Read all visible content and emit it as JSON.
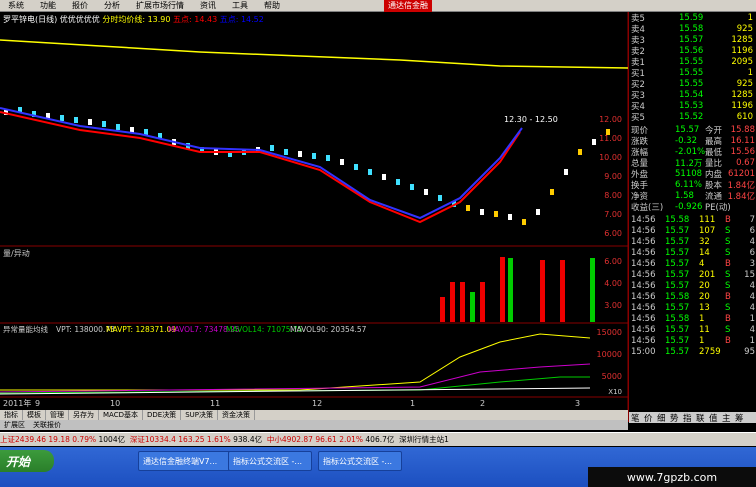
{
  "menu": [
    "系统",
    "功能",
    "报价",
    "分析",
    "扩展市场行情",
    "资讯",
    "工具",
    "帮助"
  ],
  "brand": "通达信金融",
  "chart": {
    "title": "罗平锌电(日线)",
    "title2": "优优优优优",
    "indicator": "分时均价线: 13.90",
    "ind2": "五点: 14.43",
    "ind3": "五点: 14.52",
    "price_axis": [
      "12.00",
      "11.00",
      "10.00",
      "9.00",
      "8.00",
      "7.00",
      "6.00"
    ],
    "price_label": "12.30 - 12.50",
    "vol_title": "量/异动",
    "vol_axis": [
      "6.00",
      "4.00",
      "3.00"
    ],
    "vpt_label": "异常量能均线",
    "vpt": "VPT: 138000.73",
    "mavpt": "MAVPT: 128371.09",
    "mavol7": "MAVOL7: 73478.25",
    "mavol14": "MAVOL14: 71075.75",
    "mavol90": "MAVOL90: 20354.57",
    "vpt_axis": [
      "15000",
      "10000",
      "5000"
    ],
    "x_axis": [
      "2011年",
      "9",
      "10",
      "11",
      "12",
      "1",
      "2",
      "3"
    ],
    "x_unit": "X10"
  },
  "toolbar": [
    "指标",
    "模板",
    "管理",
    "另存为",
    "MACD基本",
    "DDE决策",
    "SUP决策",
    "资金决策"
  ],
  "toolbar2": [
    "扩展区",
    "关联报价"
  ],
  "orderbook": [
    {
      "l": "卖5",
      "p": "15.59",
      "v": "1"
    },
    {
      "l": "卖4",
      "p": "15.58",
      "v": "925"
    },
    {
      "l": "卖3",
      "p": "15.57",
      "v": "1285"
    },
    {
      "l": "卖2",
      "p": "15.56",
      "v": "1196"
    },
    {
      "l": "卖1",
      "p": "15.55",
      "v": "2095"
    },
    {
      "l": "买1",
      "p": "15.55",
      "v": "1"
    },
    {
      "l": "买2",
      "p": "15.55",
      "v": "925"
    },
    {
      "l": "买3",
      "p": "15.54",
      "v": "1285"
    },
    {
      "l": "买4",
      "p": "15.53",
      "v": "1196"
    },
    {
      "l": "买5",
      "p": "15.52",
      "v": "610"
    }
  ],
  "stats": [
    {
      "a": "现价",
      "b": "15.57",
      "c": "今开",
      "d": "15.88"
    },
    {
      "a": "涨跌",
      "b": "-0.32",
      "c": "最高",
      "d": "16.11"
    },
    {
      "a": "涨幅",
      "b": "-2.01%",
      "c": "最低",
      "d": "15.56"
    },
    {
      "a": "总量",
      "b": "11.2万",
      "c": "量比",
      "d": "0.67"
    },
    {
      "a": "外盘",
      "b": "51108",
      "c": "内盘",
      "d": "61201"
    },
    {
      "a": "换手",
      "b": "6.11%",
      "c": "股本",
      "d": "1.84亿"
    },
    {
      "a": "净资",
      "b": "1.58",
      "c": "流通",
      "d": "1.84亿"
    },
    {
      "a": "收益(三)",
      "b": "-0.926",
      "c": "PE(动)",
      "d": ""
    }
  ],
  "ticks": [
    {
      "t": "14:56",
      "p": "15.58",
      "v": "111",
      "s": "B",
      "n": "7"
    },
    {
      "t": "14:56",
      "p": "15.57",
      "v": "107",
      "s": "S",
      "n": "6"
    },
    {
      "t": "14:56",
      "p": "15.57",
      "v": "32",
      "s": "S",
      "n": "4"
    },
    {
      "t": "14:56",
      "p": "15.57",
      "v": "14",
      "s": "S",
      "n": "6"
    },
    {
      "t": "14:56",
      "p": "15.57",
      "v": "4",
      "s": "B",
      "n": "3"
    },
    {
      "t": "14:56",
      "p": "15.57",
      "v": "201",
      "s": "S",
      "n": "15"
    },
    {
      "t": "14:56",
      "p": "15.57",
      "v": "20",
      "s": "S",
      "n": "4"
    },
    {
      "t": "14:56",
      "p": "15.58",
      "v": "20",
      "s": "B",
      "n": "4"
    },
    {
      "t": "14:56",
      "p": "15.57",
      "v": "13",
      "s": "S",
      "n": "4"
    },
    {
      "t": "14:56",
      "p": "15.58",
      "v": "1",
      "s": "B",
      "n": "1"
    },
    {
      "t": "14:56",
      "p": "15.57",
      "v": "11",
      "s": "S",
      "n": "4"
    },
    {
      "t": "14:56",
      "p": "15.57",
      "v": "1",
      "s": "B",
      "n": "1"
    },
    {
      "t": "15:00",
      "p": "15.57",
      "v": "2759",
      "s": "",
      "n": "95"
    }
  ],
  "panel_tabs": [
    "笔",
    "价",
    "细",
    "势",
    "指",
    "联",
    "值",
    "主",
    "筹"
  ],
  "ticker": {
    "sh": "上证2439.46",
    "sh_chg": "19.18",
    "sh_pct": "0.79%",
    "sh_amt": "1004亿",
    "sz": "深证10334.4",
    "sz_chg": "163.25",
    "sz_pct": "1.61%",
    "sz_amt": "938.4亿",
    "zx": "中小4902.87",
    "zx_chg": "96.61",
    "zx_pct": "2.01%",
    "zx_amt": "406.7亿",
    "main": "深圳行情主站1"
  },
  "taskbar": {
    "start": "开始",
    "t1": "通达信金融终端V7...",
    "t2": "指标公式交流区 -...",
    "t3": "指标公式交流区 -..."
  },
  "watermark": "www.7gpzb.com"
}
